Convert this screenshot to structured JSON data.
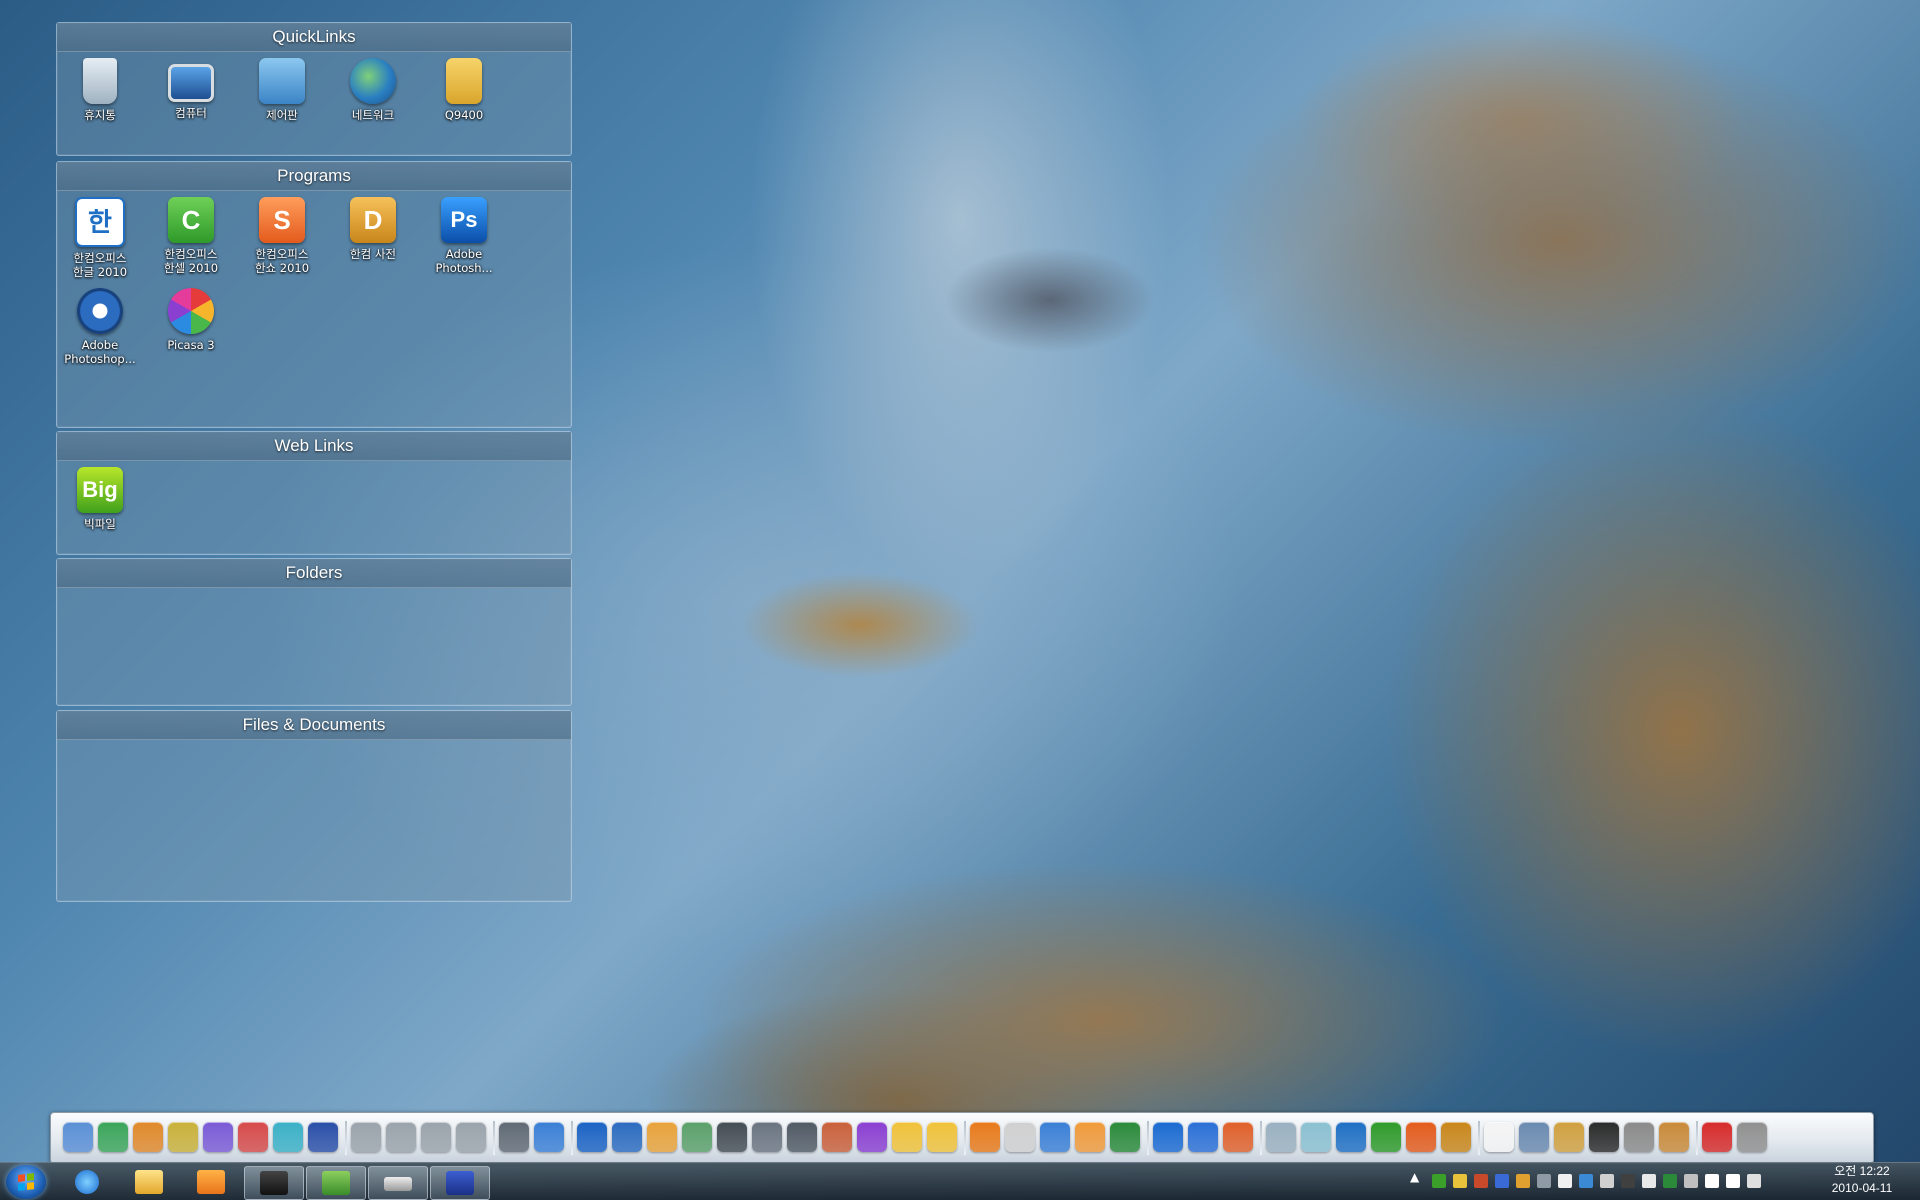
{
  "fences": {
    "quicklinks": {
      "title": "QuickLinks",
      "items": [
        {
          "label": "휴지통",
          "icon": "recycle-bin-icon"
        },
        {
          "label": "컴퓨터",
          "icon": "computer-icon"
        },
        {
          "label": "제어판",
          "icon": "control-panel-icon"
        },
        {
          "label": "네트워크",
          "icon": "network-icon"
        },
        {
          "label": "Q9400",
          "icon": "user-folder-icon"
        }
      ]
    },
    "programs": {
      "title": "Programs",
      "items": [
        {
          "label": "한컴오피스\n한글 2010",
          "icon": "hwp-icon",
          "glyph": "한"
        },
        {
          "label": "한컴오피스\n한셀 2010",
          "icon": "hancell-icon",
          "glyph": "C"
        },
        {
          "label": "한컴오피스\n한쇼 2010",
          "icon": "hanshow-icon",
          "glyph": "S"
        },
        {
          "label": "한컴 사전",
          "icon": "hancom-dictionary-icon",
          "glyph": "D"
        },
        {
          "label": "Adobe\nPhotosh...",
          "icon": "photoshop-icon",
          "glyph": "Ps"
        },
        {
          "label": "Adobe\nPhotoshop...",
          "icon": "photoshop-camera-icon",
          "glyph": ""
        },
        {
          "label": "Picasa 3",
          "icon": "picasa-icon",
          "glyph": ""
        }
      ]
    },
    "weblinks": {
      "title": "Web Links",
      "items": [
        {
          "label": "빅파일",
          "icon": "bigfile-icon",
          "glyph": "Big"
        }
      ]
    },
    "folders": {
      "title": "Folders",
      "items": []
    },
    "files": {
      "title": "Files & Documents",
      "items": []
    }
  },
  "dock": {
    "icons": [
      "printer-icon",
      "globe-icon",
      "document-icon",
      "bookmark-icon",
      "folder-icon",
      "phone-icon",
      "download-folder-icon",
      "save-icon",
      "drive-icon",
      "drive-icon",
      "drive-icon",
      "drive-icon",
      "webcam-icon",
      "satellite-icon",
      "photoshop-icon",
      "camera-icon",
      "paint-icon",
      "scanner-icon",
      "photo-icon",
      "devices-icon",
      "camera-icon",
      "tools-icon",
      "picasa-icon",
      "messenger-icon",
      "messenger-icon",
      "chain-icon",
      "penguin-icon",
      "play-icon",
      "media-icon",
      "windows-icon",
      "ie-icon",
      "appstore-icon",
      "firefox-icon",
      "document-icon",
      "eraser-icon",
      "hwp-icon",
      "hancell-icon",
      "hanshow-icon",
      "dictionary-icon",
      "clock-icon",
      "shield-icon",
      "font-icon",
      "hp-icon",
      "tools-icon",
      "hammer-icon",
      "power-icon",
      "shutdown-icon"
    ]
  },
  "taskbar": {
    "pinned": [
      "ie-icon",
      "explorer-icon",
      "media-player-icon",
      "device-manager-icon",
      "network-icon",
      "drive-icon",
      "save-icon"
    ],
    "clock_time": "오전 12:22",
    "clock_date": "2010-04-11",
    "tray_arrow": "▲"
  }
}
